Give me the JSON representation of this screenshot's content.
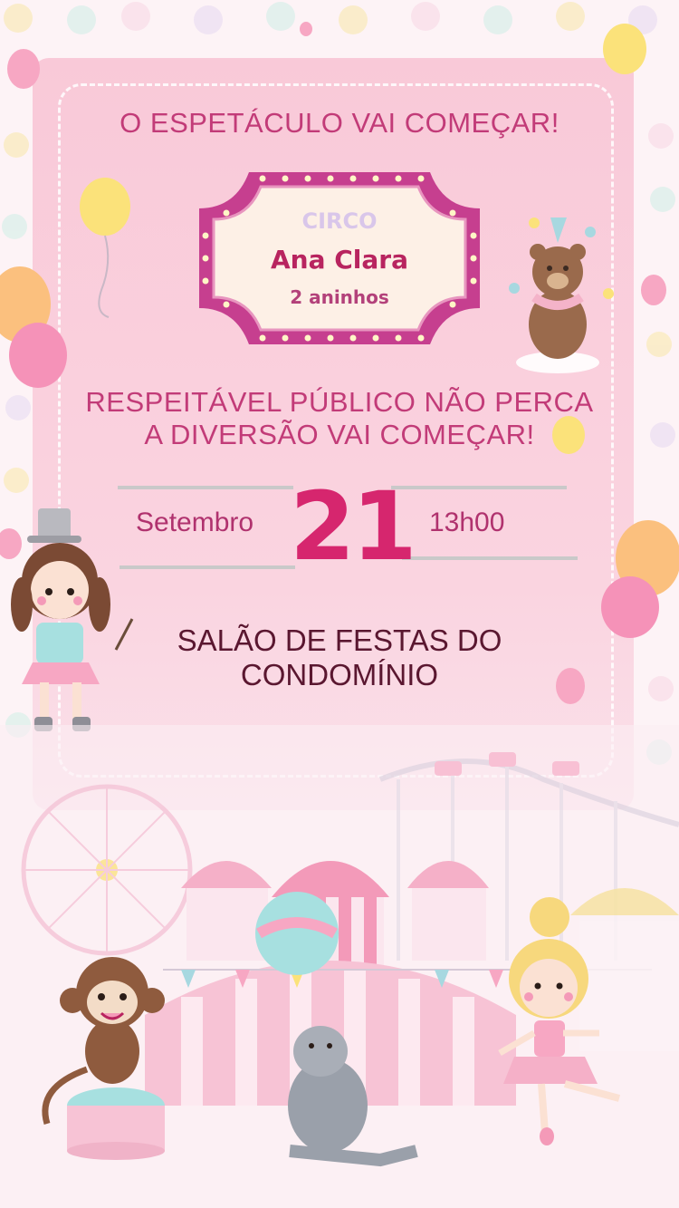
{
  "top_headline": "O ESPETÁCULO VAI COMEÇAR!",
  "marquee": {
    "label": "CIRCO",
    "name": "Ana Clara",
    "age": "2 aninhos"
  },
  "message": {
    "line1": "RESPEITÁVEL PÚBLICO NÃO PERCA",
    "line2": "A DIVERSÃO VAI COMEÇAR!"
  },
  "event": {
    "month": "Setembro",
    "day": "21",
    "time": "13h00"
  },
  "venue": {
    "line1": "SALÃO DE FESTAS DO",
    "line2": "CONDOMÍNIO"
  },
  "colors": {
    "accent": "#c23b78",
    "day": "#d6266e",
    "ticket": "#f9c9d8",
    "marquee_frame": "#c63f8f"
  },
  "illustrations": [
    "balloons",
    "bear-icon",
    "girl-ringmaster-icon",
    "circus-tents",
    "ferris-wheel",
    "monkey-icon",
    "seal-icon",
    "ballerina-icon"
  ]
}
